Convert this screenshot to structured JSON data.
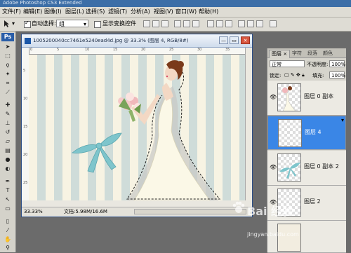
{
  "app": {
    "title": "Adobe Photoshop CS3 Extended"
  },
  "menu": [
    "文件(F)",
    "编辑(E)",
    "图像(I)",
    "图层(L)",
    "选择(S)",
    "滤镜(T)",
    "分析(A)",
    "视图(V)",
    "窗口(W)",
    "帮助(H)"
  ],
  "options": {
    "auto_select_label": "自动选择:",
    "auto_select_checked": true,
    "auto_select_value": "组",
    "show_transform_label": "显示变换控件",
    "show_transform_checked": false
  },
  "toolbox": {
    "logo": "Ps",
    "tools": [
      "move-tool",
      "marquee-tool",
      "lasso-tool",
      "magic-wand-tool",
      "crop-tool",
      "eyedropper-tool",
      "healing-tool",
      "brush-tool",
      "stamp-tool",
      "history-brush-tool",
      "eraser-tool",
      "gradient-tool",
      "blur-tool",
      "dodge-tool",
      "pen-tool",
      "type-tool",
      "path-select-tool",
      "shape-tool",
      "hand-tool",
      "zoom-tool",
      "color-swatch"
    ]
  },
  "document": {
    "title": "1005200040cc7461e5240ead4d.jpg @ 33.3% (图层 4, RGB/8#)",
    "zoom": "33.33%",
    "doc_size": "文档:5.98M/16.6M",
    "ruler_top": [
      "0",
      "5",
      "10",
      "15",
      "20",
      "25",
      "30",
      "35"
    ],
    "ruler_left": [
      "5",
      "10",
      "15",
      "20",
      "25"
    ]
  },
  "layers_panel": {
    "tabs": [
      "图层 ×",
      "字符",
      "段落",
      "颜色"
    ],
    "blend_mode": "正常",
    "opacity_label": "不透明度:",
    "opacity_value": "100%",
    "lock_label": "锁定:",
    "fill_label": "填充:",
    "fill_value": "100%",
    "layers": [
      {
        "name": "图层 0 副本",
        "visible": true,
        "selected": false
      },
      {
        "name": "图层 4",
        "visible": false,
        "selected": true
      },
      {
        "name": "图层 0 副本 2",
        "visible": true,
        "selected": false
      },
      {
        "name": "图层 2",
        "visible": true,
        "selected": false
      }
    ]
  },
  "watermark": {
    "brand": "Bai 经验",
    "url": "jingyan.baidu.com"
  },
  "colors": {
    "selection": "#3a86e6",
    "title_bar": "#3c6ea7",
    "bow": "#7ec5cc"
  }
}
